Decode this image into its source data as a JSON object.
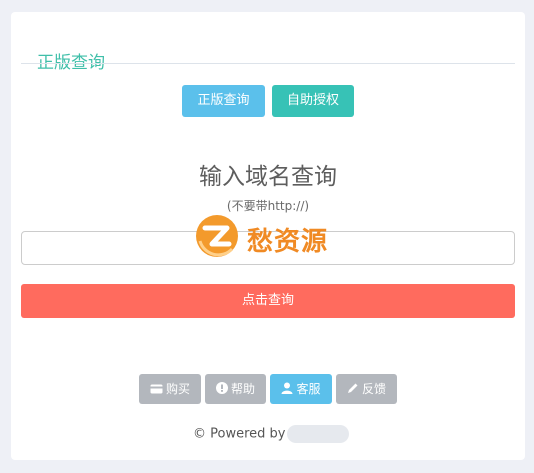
{
  "page": {
    "title": "正版查询"
  },
  "toolbar": {
    "check_label": "正版查询",
    "auth_label": "自助授权"
  },
  "query": {
    "heading": "输入域名查询",
    "hint": "(不要带http://)",
    "input_value": "",
    "input_placeholder": "",
    "submit_label": "点击查询"
  },
  "watermark": {
    "text": "愁资源"
  },
  "footer_buttons": {
    "buy": {
      "label": "购买",
      "icon": "credit-card-icon"
    },
    "help": {
      "label": "帮助",
      "icon": "exclamation-circle-icon"
    },
    "service": {
      "label": "客服",
      "icon": "user-icon"
    },
    "feedback": {
      "label": "反馈",
      "icon": "pencil-icon"
    }
  },
  "footer": {
    "powered_text": "© Powered by"
  },
  "colors": {
    "accent": "#3fbfa9",
    "check_button": "#5bc0eb",
    "auth_button": "#37c2b6",
    "submit_button": "#ff6b5e",
    "gray_button": "#b3b7bd",
    "watermark": "#f08a24"
  }
}
